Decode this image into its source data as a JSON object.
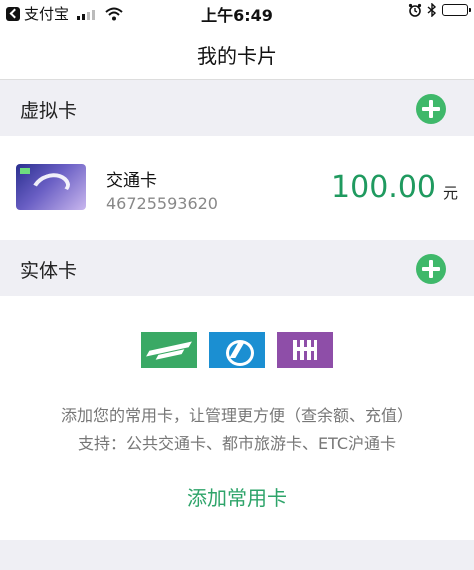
{
  "status_bar": {
    "app_name": "支付宝",
    "time": "上午6:49",
    "signal_icon": "signal-icon",
    "wifi_icon": "wifi-icon",
    "alarm_icon": "alarm-icon",
    "bluetooth_icon": "bluetooth-icon",
    "battery_icon": "battery-icon"
  },
  "nav": {
    "title": "我的卡片"
  },
  "virtual_section": {
    "title": "虚拟卡",
    "add_icon": "plus-circle-icon"
  },
  "virtual_card": {
    "name": "交通卡",
    "number": "46725593620",
    "balance": "100.00",
    "unit": "元"
  },
  "physical_section": {
    "title": "实体卡",
    "add_icon": "plus-circle-icon"
  },
  "physical_panel": {
    "logos": [
      "green-transit-logo",
      "blue-transit-logo",
      "purple-transit-logo"
    ],
    "hint_line1": "添加您的常用卡，让管理更方便（查余额、充值）",
    "hint_line2": "支持：公共交通卡、都市旅游卡、ETC沪通卡",
    "add_button": "添加常用卡"
  },
  "colors": {
    "accent_green": "#3fb86a",
    "balance_green": "#1f9a5f",
    "background": "#efeff4"
  }
}
